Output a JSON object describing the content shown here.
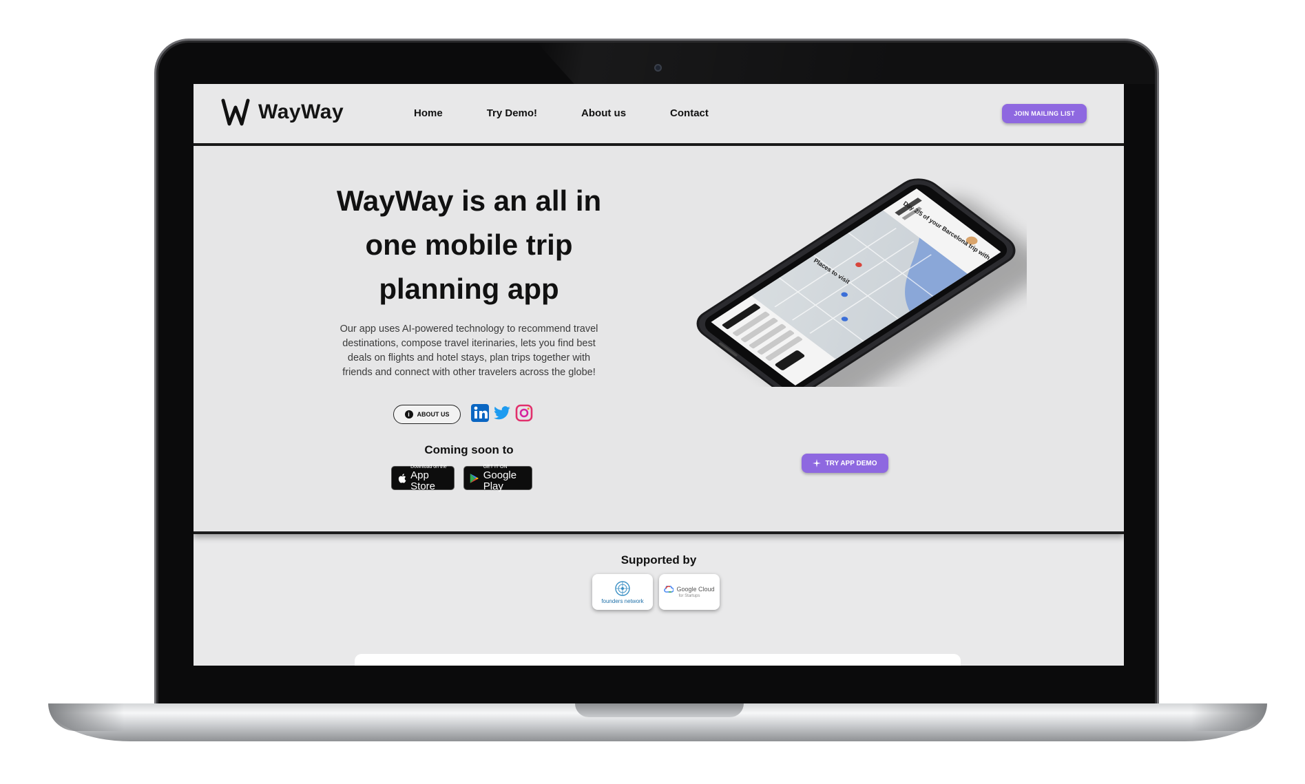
{
  "brand": {
    "name": "WayWay"
  },
  "nav": {
    "links": [
      "Home",
      "Try Demo!",
      "About us",
      "Contact"
    ],
    "join_label": "JOIN MAILING LIST"
  },
  "hero": {
    "title": "WayWay is an all in one mobile trip planning app",
    "description": "Our app uses AI-powered technology to recommend travel destinations, compose travel iterinaries, lets you find best deals on flights and hotel stays, plan trips together with friends and connect with other travelers across the globe!",
    "about_label": "ABOUT US",
    "coming_soon": "Coming soon to",
    "app_store": {
      "small": "Download on the",
      "large": "App Store"
    },
    "google_play": {
      "small": "GET IT ON",
      "large": "Google Play"
    },
    "try_demo_label": "TRY APP DEMO",
    "phone_screen": {
      "header": "Day 2/5 of your Barcelona trip with",
      "section": "Places to visit"
    }
  },
  "supported": {
    "title": "Supported by",
    "partners": [
      {
        "name": "founders network"
      },
      {
        "name": "Google Cloud",
        "sub": "for Startups"
      }
    ]
  },
  "colors": {
    "accent": "#8e68e0",
    "linkedin": "#0a66c2",
    "twitter": "#1d9bf0",
    "instagram": "#e1306c"
  },
  "icons": [
    "waymay-logo-icon",
    "info-icon",
    "linkedin-icon",
    "twitter-icon",
    "instagram-icon",
    "apple-icon",
    "google-play-icon",
    "sparkle-icon"
  ]
}
